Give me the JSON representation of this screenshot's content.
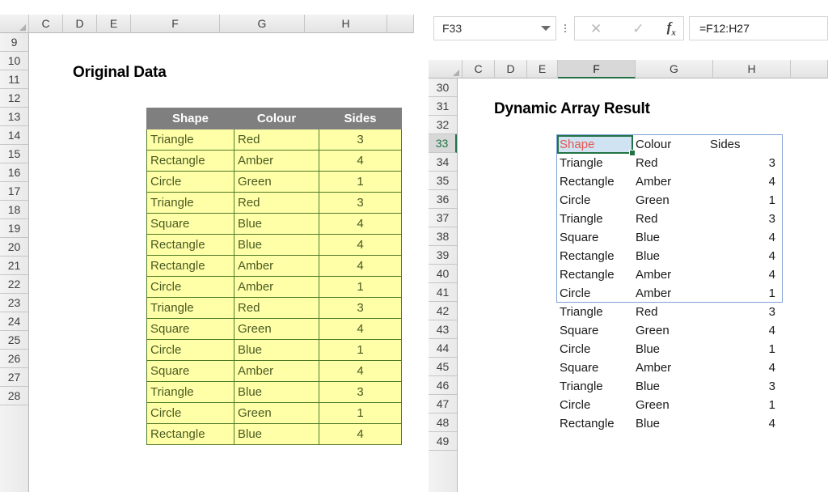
{
  "left_pane": {
    "title": "Original Data",
    "column_headers": [
      "C",
      "D",
      "E",
      "F",
      "G",
      "H"
    ],
    "row_headers": [
      "9",
      "10",
      "11",
      "12",
      "13",
      "14",
      "15",
      "16",
      "17",
      "18",
      "19",
      "20",
      "21",
      "22",
      "23",
      "24",
      "25",
      "26",
      "27",
      "28"
    ],
    "table": {
      "headers": [
        "Shape",
        "Colour",
        "Sides"
      ],
      "rows": [
        [
          "Triangle",
          "Red",
          "3"
        ],
        [
          "Rectangle",
          "Amber",
          "4"
        ],
        [
          "Circle",
          "Green",
          "1"
        ],
        [
          "Triangle",
          "Red",
          "3"
        ],
        [
          "Square",
          "Blue",
          "4"
        ],
        [
          "Rectangle",
          "Blue",
          "4"
        ],
        [
          "Rectangle",
          "Amber",
          "4"
        ],
        [
          "Circle",
          "Amber",
          "1"
        ],
        [
          "Triangle",
          "Red",
          "3"
        ],
        [
          "Square",
          "Green",
          "4"
        ],
        [
          "Circle",
          "Blue",
          "1"
        ],
        [
          "Square",
          "Amber",
          "4"
        ],
        [
          "Triangle",
          "Blue",
          "3"
        ],
        [
          "Circle",
          "Green",
          "1"
        ],
        [
          "Rectangle",
          "Blue",
          "4"
        ]
      ],
      "header_bg": "#7f7f7f",
      "header_fg": "#ffffff",
      "cell_bg": "#ffffa8",
      "cell_fg": "#4a5a21",
      "cell_border": "#4f7a28"
    }
  },
  "right_pane": {
    "title": "Dynamic Array Result",
    "column_headers": [
      "C",
      "D",
      "E",
      "F",
      "G",
      "H"
    ],
    "active_column": "F",
    "row_headers": [
      "30",
      "31",
      "32",
      "33",
      "34",
      "35",
      "36",
      "37",
      "38",
      "39",
      "40",
      "41",
      "42",
      "43",
      "44",
      "45",
      "46",
      "47",
      "48",
      "49"
    ],
    "active_row": "33",
    "formula_bar": {
      "name_box_value": "F33",
      "name_box_dropdown": "chevron-down-icon",
      "cancel_icon": "✕",
      "confirm_icon": "✓",
      "function_icon": "fx",
      "formula_value": "=F12:H27"
    },
    "spill_range": {
      "border_color": "#7f9fd4",
      "selected_cell": {
        "text": "Shape",
        "fill": "#cfe3f2",
        "text_color": "#e8564f",
        "outline_color": "#217346"
      },
      "rows": [
        [
          "Shape",
          "Colour",
          "Sides"
        ],
        [
          "Triangle",
          "Red",
          "3"
        ],
        [
          "Rectangle",
          "Amber",
          "4"
        ],
        [
          "Circle",
          "Green",
          "1"
        ],
        [
          "Triangle",
          "Red",
          "3"
        ],
        [
          "Square",
          "Blue",
          "4"
        ],
        [
          "Rectangle",
          "Blue",
          "4"
        ],
        [
          "Rectangle",
          "Amber",
          "4"
        ],
        [
          "Circle",
          "Amber",
          "1"
        ],
        [
          "Triangle",
          "Red",
          "3"
        ],
        [
          "Square",
          "Green",
          "4"
        ],
        [
          "Circle",
          "Blue",
          "1"
        ],
        [
          "Square",
          "Amber",
          "4"
        ],
        [
          "Triangle",
          "Blue",
          "3"
        ],
        [
          "Circle",
          "Green",
          "1"
        ],
        [
          "Rectangle",
          "Blue",
          "4"
        ]
      ]
    }
  }
}
